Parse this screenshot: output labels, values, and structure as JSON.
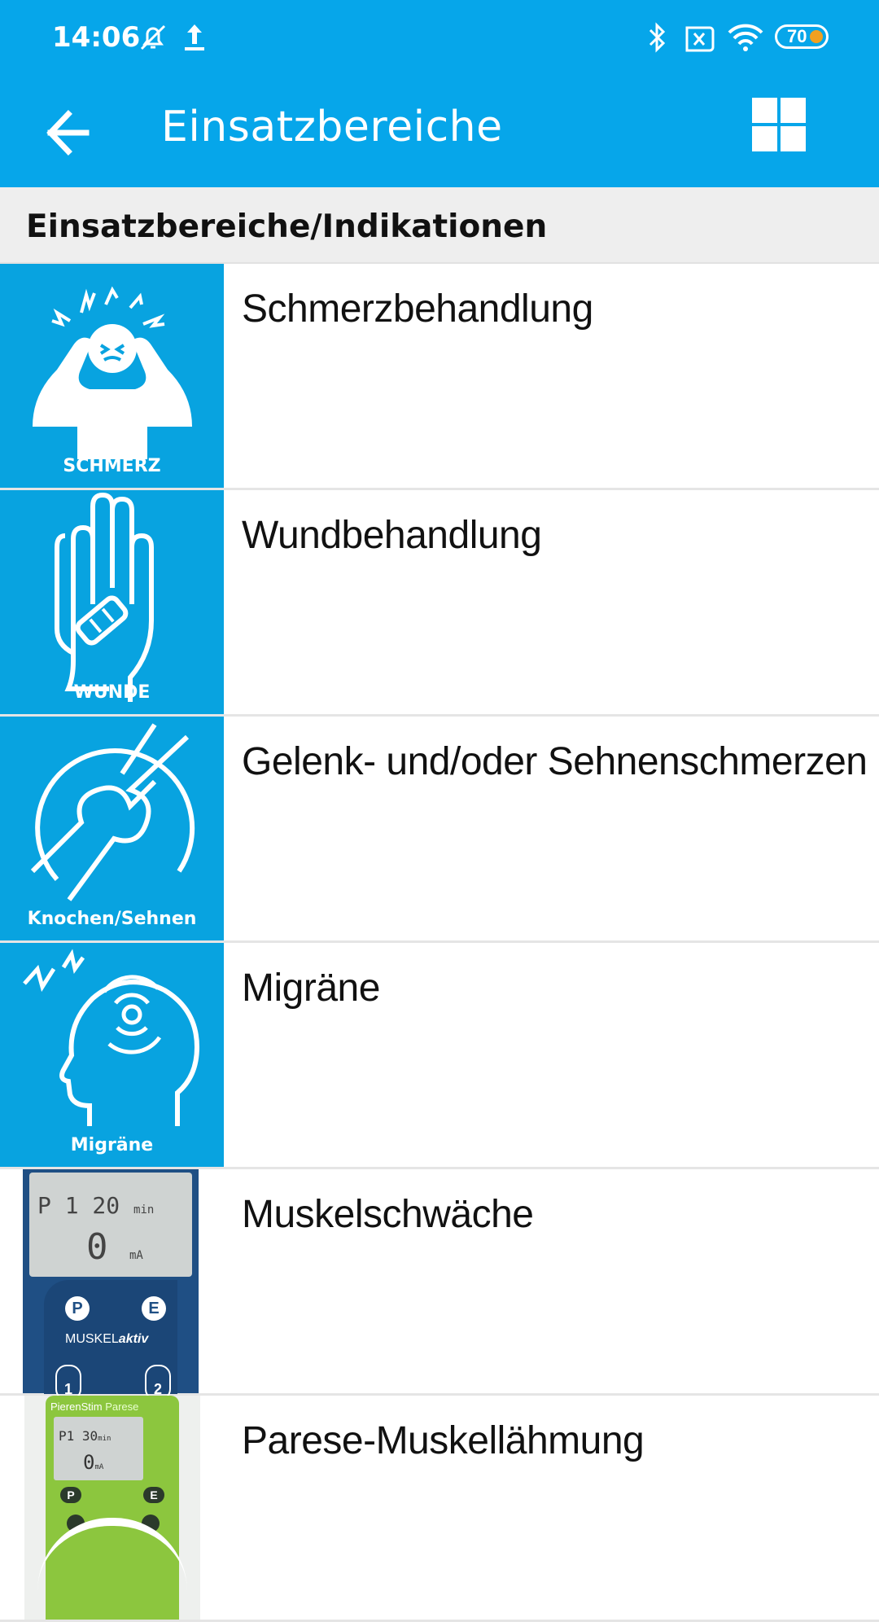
{
  "status_bar": {
    "time": "14:06",
    "icons": [
      "muted-bell-icon",
      "upload-icon",
      "bluetooth-icon",
      "sim-x-icon",
      "wifi-icon",
      "battery-icon"
    ],
    "battery": "70"
  },
  "app_bar": {
    "title": "Einsatzbereiche",
    "back_icon": "arrow-left-icon",
    "grid_icon": "grid-icon"
  },
  "section": {
    "title": "Einsatzbereiche/Indikationen"
  },
  "items": [
    {
      "label": "Schmerzbehandlung",
      "caption": "SCHMERZ"
    },
    {
      "label": "Wundbehandlung",
      "caption": "WUNDE"
    },
    {
      "label": "Gelenk- und/oder Sehnenschmerzen",
      "caption": "Knochen/Sehnen"
    },
    {
      "label": "Migräne",
      "caption": "Migräne"
    },
    {
      "label": "Muskelschwäche",
      "device": {
        "line1": "P 1 20",
        "unit1": "min",
        "line2": "0",
        "unit2": "mA",
        "brand_a": "MUSKEL",
        "brand_b": "aktiv",
        "btn_p": "P",
        "btn_e": "E",
        "ch1": "1",
        "ch2": "2"
      }
    },
    {
      "label": "Parese-Muskellähmung",
      "device": {
        "brand_a": "PierenStim",
        "brand_b": "Parese",
        "line1": "P1 30",
        "unit1": "min",
        "line2": "0",
        "unit2": "mA",
        "btn_p": "P",
        "btn_e": "E"
      }
    }
  ],
  "colors": {
    "primary": "#06a6ea",
    "tile": "#08a3e0",
    "section_bg": "#eeeeee"
  }
}
